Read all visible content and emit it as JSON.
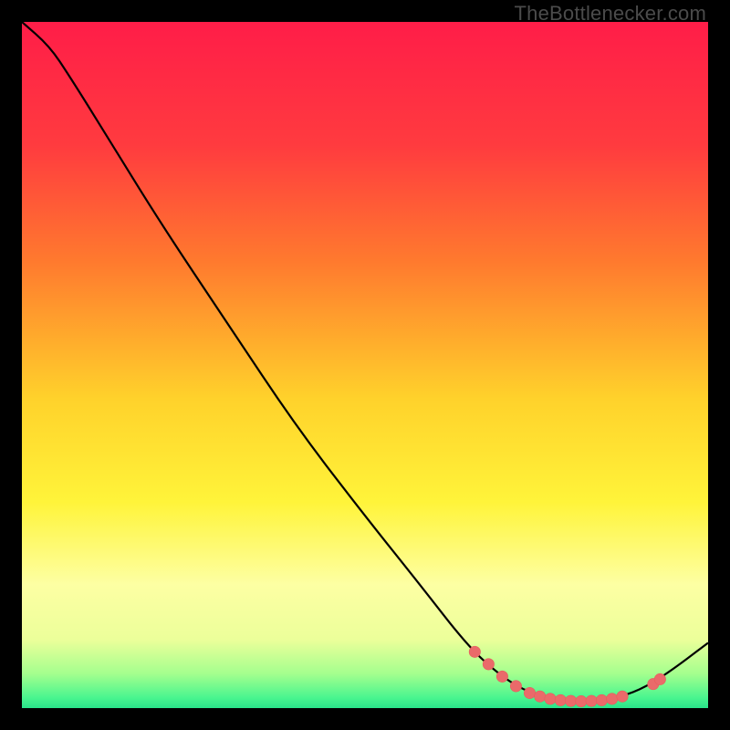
{
  "watermark": "TheBottlenecker.com",
  "colors": {
    "gradient_stops": [
      {
        "offset": 0.0,
        "color": "#ff1d48"
      },
      {
        "offset": 0.18,
        "color": "#ff3b3f"
      },
      {
        "offset": 0.35,
        "color": "#ff7a2e"
      },
      {
        "offset": 0.55,
        "color": "#ffd22b"
      },
      {
        "offset": 0.7,
        "color": "#fff43a"
      },
      {
        "offset": 0.82,
        "color": "#fdffa3"
      },
      {
        "offset": 0.9,
        "color": "#ecff9a"
      },
      {
        "offset": 0.95,
        "color": "#a4ff8e"
      },
      {
        "offset": 0.985,
        "color": "#49f58f"
      },
      {
        "offset": 1.0,
        "color": "#29e38a"
      }
    ],
    "curve": "#000000",
    "marker_fill": "#ea6a6a",
    "marker_stroke": "#e85c5c"
  },
  "chart_data": {
    "type": "line",
    "title": "",
    "xlabel": "",
    "ylabel": "",
    "xlim": [
      0,
      100
    ],
    "ylim": [
      0,
      100
    ],
    "legend": false,
    "curve": [
      {
        "x": 0,
        "y": 100
      },
      {
        "x": 4,
        "y": 96.5
      },
      {
        "x": 7,
        "y": 92
      },
      {
        "x": 12,
        "y": 84
      },
      {
        "x": 20,
        "y": 71
      },
      {
        "x": 30,
        "y": 56
      },
      {
        "x": 40,
        "y": 41
      },
      {
        "x": 50,
        "y": 28
      },
      {
        "x": 58,
        "y": 18
      },
      {
        "x": 65,
        "y": 9
      },
      {
        "x": 70,
        "y": 4.5
      },
      {
        "x": 74,
        "y": 2.2
      },
      {
        "x": 78,
        "y": 1.2
      },
      {
        "x": 82,
        "y": 1.0
      },
      {
        "x": 86,
        "y": 1.3
      },
      {
        "x": 90,
        "y": 2.6
      },
      {
        "x": 94,
        "y": 5.0
      },
      {
        "x": 100,
        "y": 9.5
      }
    ],
    "markers": [
      {
        "x": 66,
        "y": 8.2
      },
      {
        "x": 68,
        "y": 6.4
      },
      {
        "x": 70,
        "y": 4.6
      },
      {
        "x": 72,
        "y": 3.2
      },
      {
        "x": 74,
        "y": 2.2
      },
      {
        "x": 75.5,
        "y": 1.7
      },
      {
        "x": 77,
        "y": 1.35
      },
      {
        "x": 78.5,
        "y": 1.15
      },
      {
        "x": 80,
        "y": 1.05
      },
      {
        "x": 81.5,
        "y": 1.0
      },
      {
        "x": 83,
        "y": 1.05
      },
      {
        "x": 84.5,
        "y": 1.15
      },
      {
        "x": 86,
        "y": 1.35
      },
      {
        "x": 87.5,
        "y": 1.7
      },
      {
        "x": 92,
        "y": 3.5
      },
      {
        "x": 93,
        "y": 4.2
      }
    ]
  }
}
